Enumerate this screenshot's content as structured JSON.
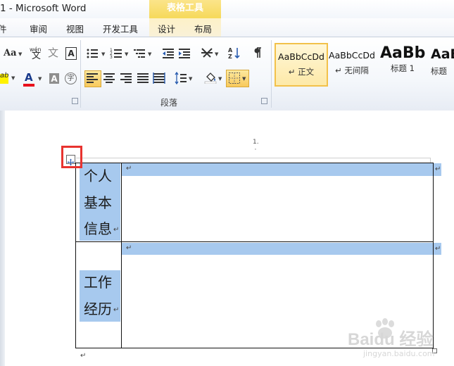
{
  "window": {
    "title": "1 - Microsoft Word",
    "context_title": "表格工具"
  },
  "tabs": [
    {
      "label": "件"
    },
    {
      "label": "审阅"
    },
    {
      "label": "视图"
    },
    {
      "label": "开发工具"
    },
    {
      "label": "设计"
    },
    {
      "label": "布局"
    }
  ],
  "ribbon": {
    "font_group": {
      "change_case": "Aa",
      "phonetic_char": "wén",
      "border_char_a": "A",
      "shading_char_a": "A",
      "enclosed_char": "字",
      "font_color_char": "A",
      "highlight_char": "ab"
    },
    "paragraph_group": {
      "label": "段落"
    },
    "styles": [
      {
        "preview": "AaBbCcDd",
        "name": "↵ 正文"
      },
      {
        "preview": "AaBbCcDd",
        "name": "↵ 无间隔"
      },
      {
        "preview": "AaBb",
        "name": "标题 1"
      },
      {
        "preview": "AaB",
        "name": "标题"
      }
    ]
  },
  "colors": {
    "selection": "#a7c9ee",
    "highlight_red": "#e8101c",
    "context_tab": "#f6d95a",
    "callout_red": "#e8332f"
  },
  "document": {
    "header_mark": "1.",
    "table": {
      "row1_label_lines": [
        "个人",
        "基本",
        "信息"
      ],
      "row2_label_lines": [
        "工作",
        "经历"
      ]
    },
    "cell_end_mark": "↵",
    "paragraph_mark": "↵",
    "move_handle_icon": "four-arrows-icon"
  },
  "watermark": {
    "text": "Baidu 经验",
    "subtext": "jingyan.baidu.com"
  }
}
